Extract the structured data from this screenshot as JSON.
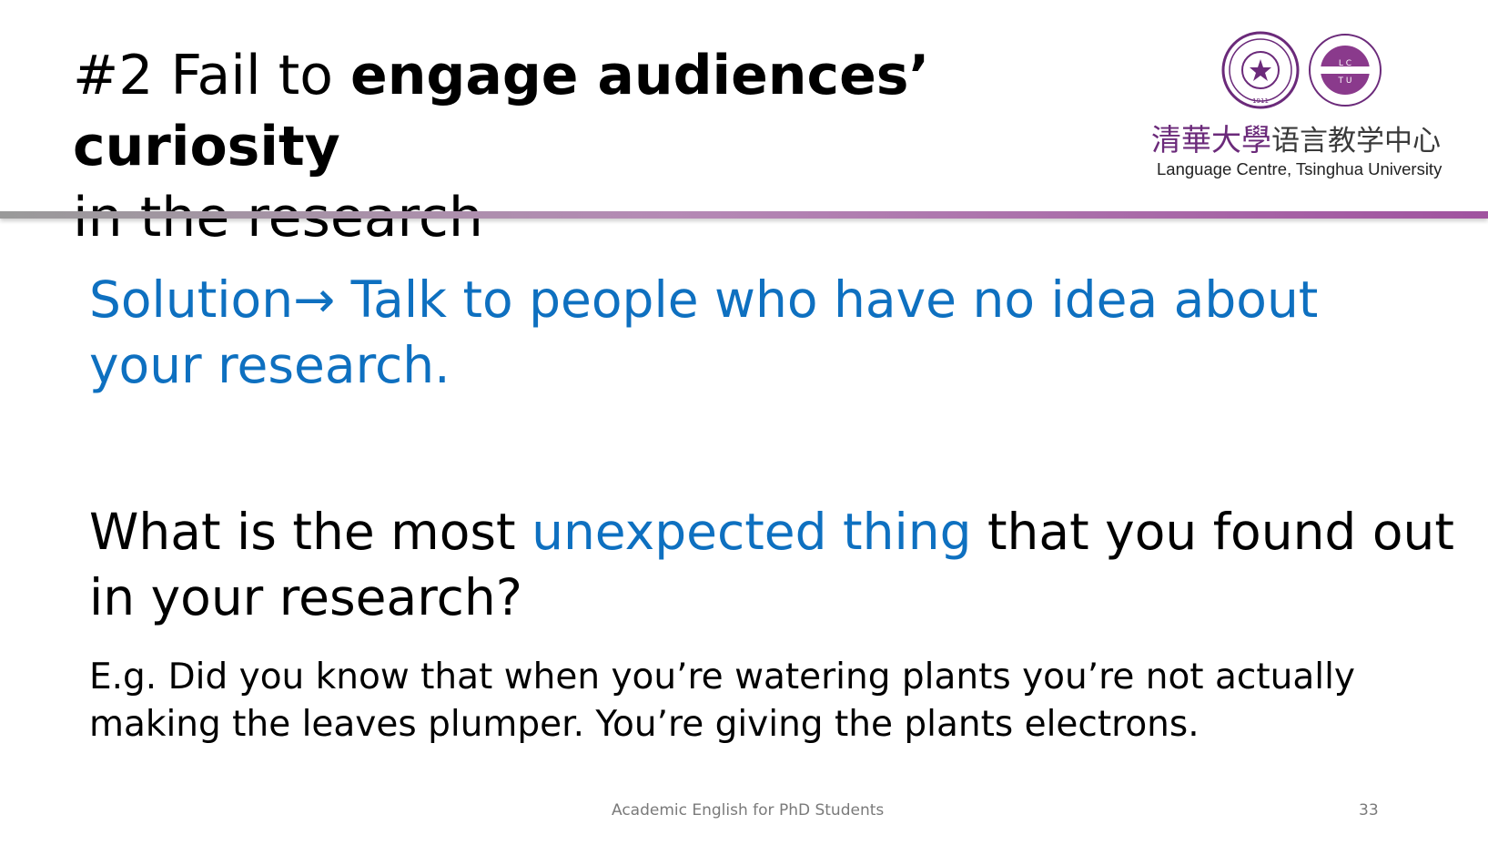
{
  "title": {
    "prefix": "#2 Fail to ",
    "bold": "engage audiences’ curiosity",
    "line2": "in the research"
  },
  "logo": {
    "cn_name_calligraphy": "清華大學",
    "cn_name_plain": "语言教学中心",
    "en_name": "Language Centre, Tsinghua University",
    "seal_1_year": "1911",
    "seal_2_letters": "LCTU",
    "seal_2_text": "LANGUAGE CENTRE TSINGHUA UNIVERSITY"
  },
  "solution": {
    "label": "Solution",
    "arrow": "→",
    "text": " Talk to people who have no idea about your research."
  },
  "question": {
    "before": "What is the most ",
    "highlight": "unexpected thing",
    "after": " that you found out in your research?"
  },
  "example": "E.g. Did you know that when you’re watering plants you’re not actually making the leaves plumper. You’re giving the plants electrons.",
  "footer": {
    "course": "Academic English for PhD Students",
    "page": "33"
  },
  "colors": {
    "accent_blue": "#0e70c0",
    "brand_purple": "#6b2a7a"
  }
}
